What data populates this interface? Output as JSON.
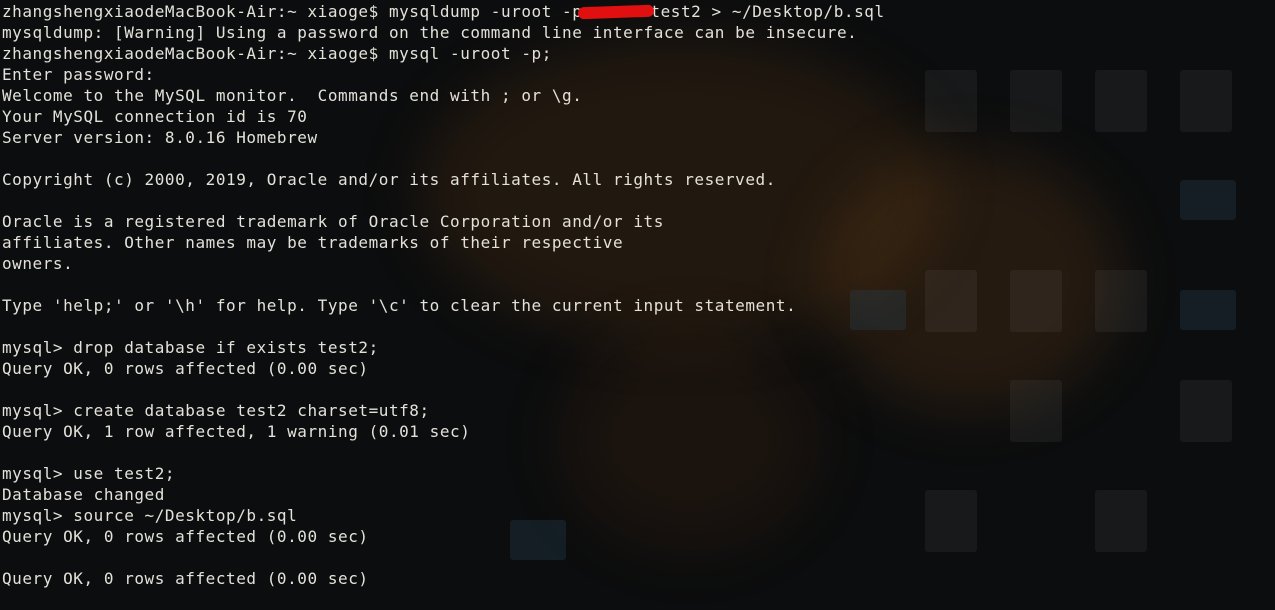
{
  "terminal": {
    "lines": [
      {
        "segments": [
          "zhangshengxiaodeMacBook-Air:~ xiaoge$ mysqldump -uroot -p",
          "test2 > ~/Desktop/b.sql"
        ],
        "redacted": true
      },
      {
        "text": "mysqldump: [Warning] Using a password on the command line interface can be insecure."
      },
      {
        "text": "zhangshengxiaodeMacBook-Air:~ xiaoge$ mysql -uroot -p;"
      },
      {
        "text": "Enter password:"
      },
      {
        "text": "Welcome to the MySQL monitor.  Commands end with ; or \\g."
      },
      {
        "text": "Your MySQL connection id is 70"
      },
      {
        "text": "Server version: 8.0.16 Homebrew"
      },
      {
        "text": ""
      },
      {
        "text": "Copyright (c) 2000, 2019, Oracle and/or its affiliates. All rights reserved."
      },
      {
        "text": ""
      },
      {
        "text": "Oracle is a registered trademark of Oracle Corporation and/or its"
      },
      {
        "text": "affiliates. Other names may be trademarks of their respective"
      },
      {
        "text": "owners."
      },
      {
        "text": ""
      },
      {
        "text": "Type 'help;' or '\\h' for help. Type '\\c' to clear the current input statement."
      },
      {
        "text": ""
      },
      {
        "text": "mysql> drop database if exists test2;"
      },
      {
        "text": "Query OK, 0 rows affected (0.00 sec)"
      },
      {
        "text": ""
      },
      {
        "text": "mysql> create database test2 charset=utf8;"
      },
      {
        "text": "Query OK, 1 row affected, 1 warning (0.01 sec)"
      },
      {
        "text": ""
      },
      {
        "text": "mysql> use test2;"
      },
      {
        "text": "Database changed"
      },
      {
        "text": "mysql> source ~/Desktop/b.sql"
      },
      {
        "text": "Query OK, 0 rows affected (0.00 sec)"
      },
      {
        "text": ""
      },
      {
        "text": "Query OK, 0 rows affected (0.00 sec)"
      }
    ]
  },
  "colors": {
    "text": "#e3e1d9",
    "background": "#0c0d0e",
    "redaction": "#e01010"
  }
}
